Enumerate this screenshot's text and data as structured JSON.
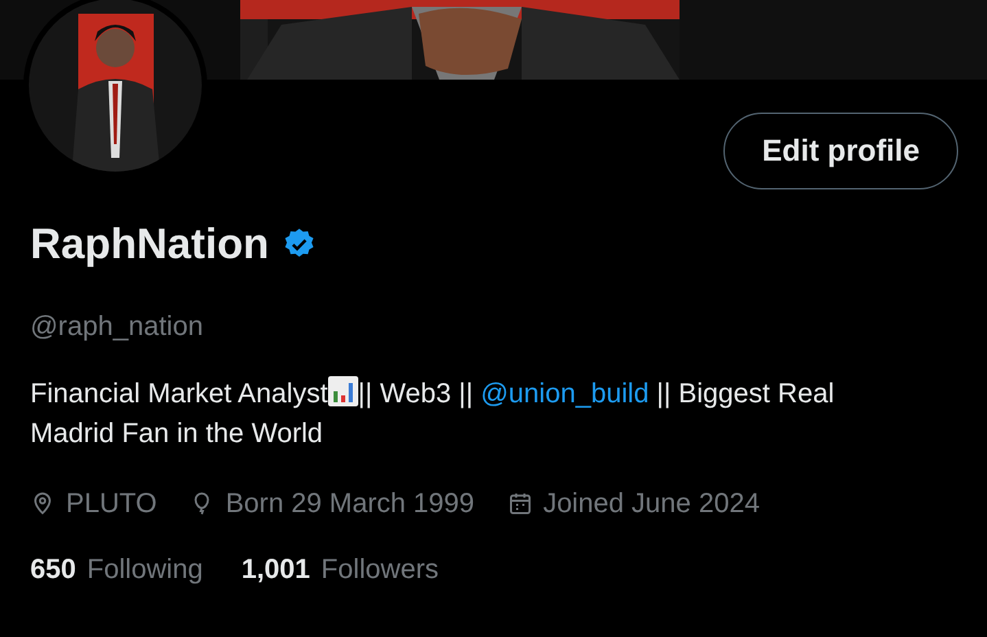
{
  "edit_button": {
    "label": "Edit profile"
  },
  "profile": {
    "name": "RaphNation",
    "verified": true,
    "handle": "@raph_nation"
  },
  "bio": [
    {
      "kind": "text",
      "text": "Financial Market Analyst"
    },
    {
      "kind": "chart-emoji"
    },
    {
      "kind": "text",
      "text": "|| Web3 || "
    },
    {
      "kind": "mention",
      "text": "@union_build"
    },
    {
      "kind": "text",
      "text": " || Biggest Real Madrid Fan in the World"
    }
  ],
  "meta": [
    {
      "kind": "location",
      "text": "PLUTO"
    },
    {
      "kind": "birthday",
      "text": "Born 29 March 1999"
    },
    {
      "kind": "joined",
      "text": "Joined June 2024"
    }
  ],
  "stats": [
    {
      "count": "650",
      "label": "Following"
    },
    {
      "count": "1,001",
      "label": "Followers"
    }
  ]
}
